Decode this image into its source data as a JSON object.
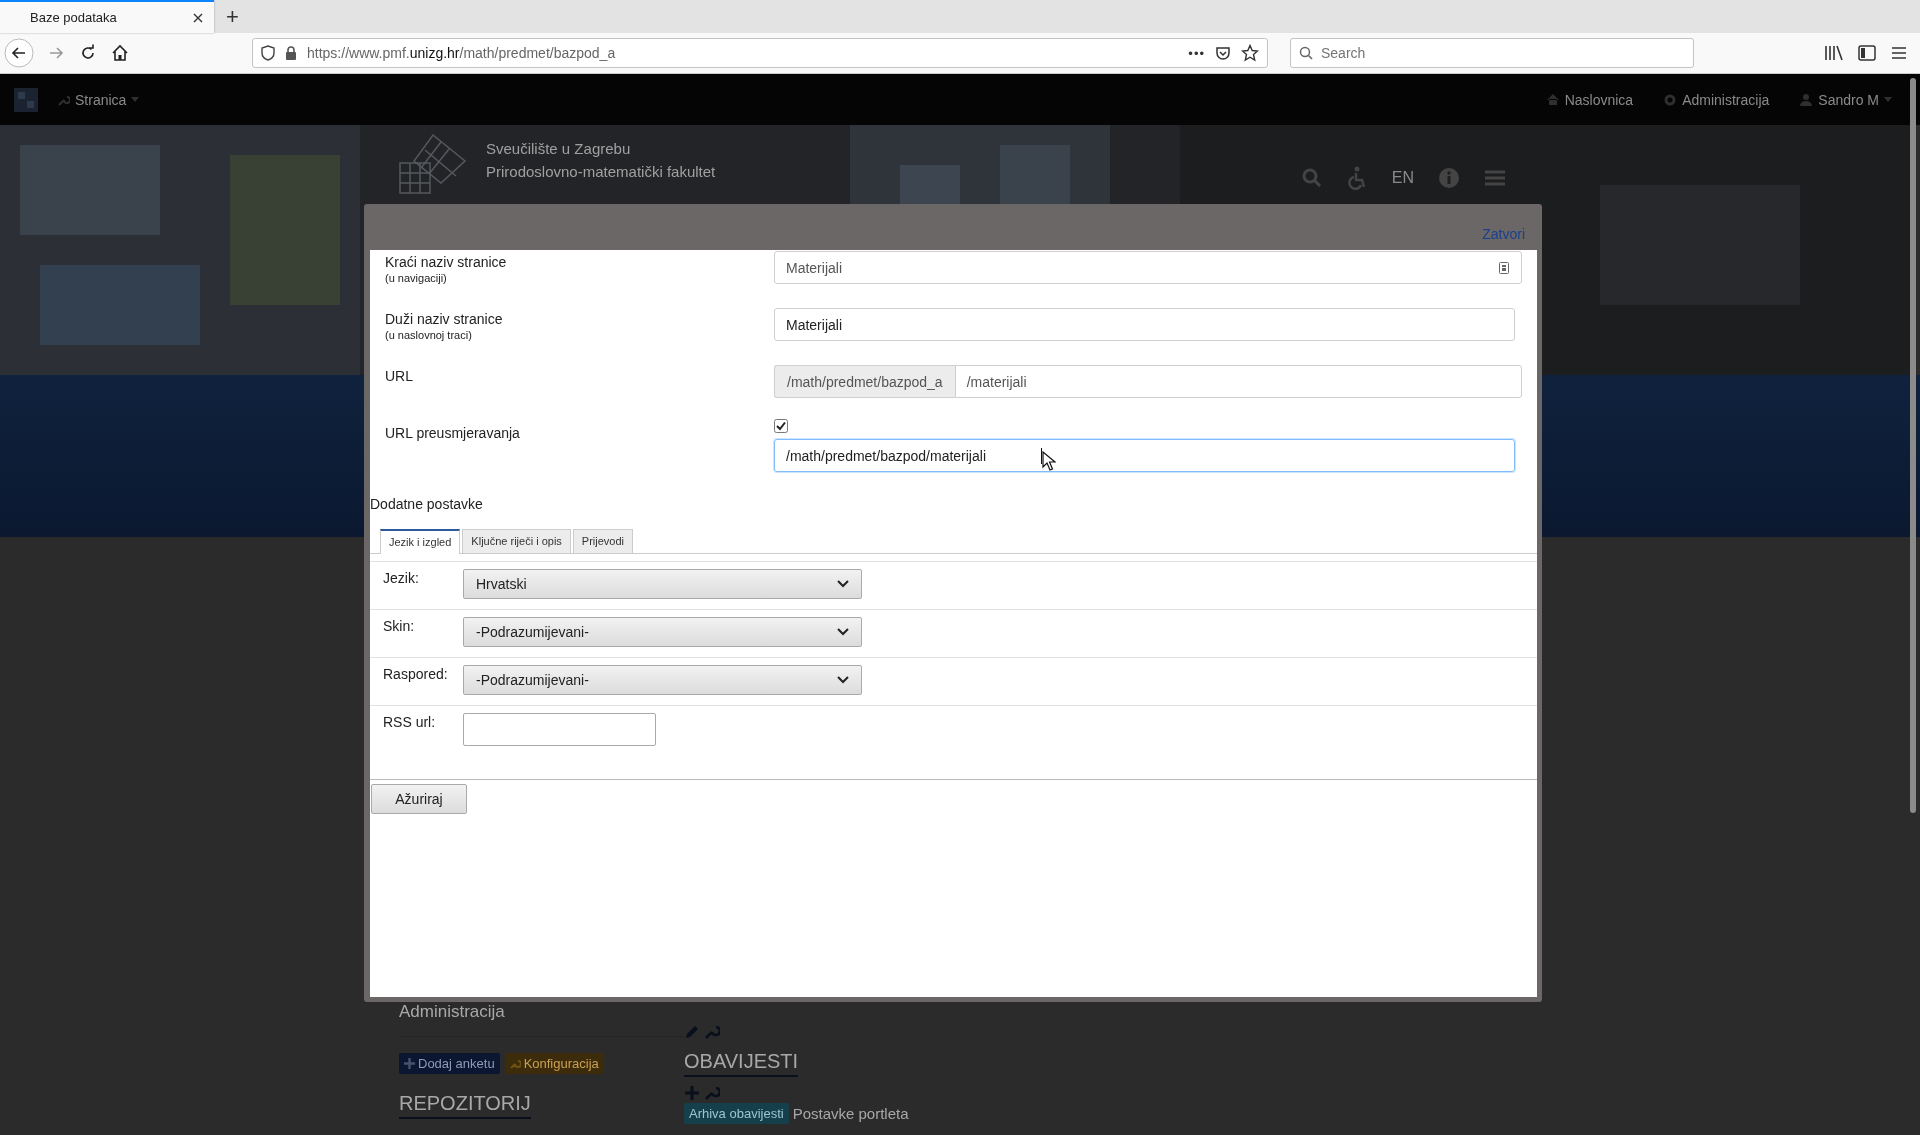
{
  "browser": {
    "tabs": [
      {
        "title": "Baze podataka",
        "selected": true
      }
    ],
    "new_tab": "+",
    "url": "https://www.pmf.**unizg.hr**/math/predmet/bazpod_a",
    "page_actions": "•••",
    "search": {
      "placeholder": "Search"
    }
  },
  "site": {
    "navbar": {
      "menu": "Stranica",
      "links": [
        "Naslovnica",
        "Administracija",
        "Sandro M"
      ]
    },
    "header": {
      "lines": [
        "Sveučilište u Zagrebu",
        "Prirodoslovno-matematički fakultet"
      ],
      "language": "EN"
    },
    "left": {
      "title": "Administracija",
      "buttons": [
        {
          "label": "Dodaj anketu",
          "kind": "primary"
        },
        {
          "label": "Konfiguracija",
          "kind": "warning"
        }
      ],
      "section": "REPOZITORIJ"
    },
    "right": {
      "section": "OBAVIJESTI",
      "archive_button": "Arhiva obavijesti",
      "settings": "Postavke portleta"
    }
  },
  "dialog": {
    "close": "Zatvori",
    "fields": [
      {
        "label": "Kraći naziv stranice",
        "hint": "(u navigaciji)",
        "kind": "text",
        "value": "Materijali",
        "focused": false
      },
      {
        "label": "Duži naziv stranice",
        "hint": "(u naslovnoj traci)",
        "kind": "text",
        "value": "Materijali",
        "focused": false
      },
      {
        "label": "URL",
        "kind": "prefixed",
        "prefix": "/math/predmet/bazpod_a",
        "value": "/materijali",
        "focused": false
      },
      {
        "label": "URL preusmjeravanja",
        "kind": "checkbox_text",
        "checked": true,
        "value": "/math/predmet/bazpod/materijali",
        "focused": true
      }
    ],
    "section": "Dodatne postavke",
    "tabs": [
      {
        "label": "Jezik i izgled",
        "selected": true
      },
      {
        "label": "Ključne riječi i opis",
        "selected": false
      },
      {
        "label": "Prijevodi",
        "selected": false
      }
    ],
    "settings": [
      {
        "label": "Jezik:",
        "kind": "select",
        "value": "Hrvatski"
      },
      {
        "label": "Skin:",
        "kind": "select",
        "value": "-Podrazumijevani-"
      },
      {
        "label": "Raspored:",
        "kind": "select",
        "value": "-Podrazumijevani-"
      },
      {
        "label": "RSS url:",
        "kind": "input"
      }
    ],
    "submit": "Ažuriraj"
  }
}
